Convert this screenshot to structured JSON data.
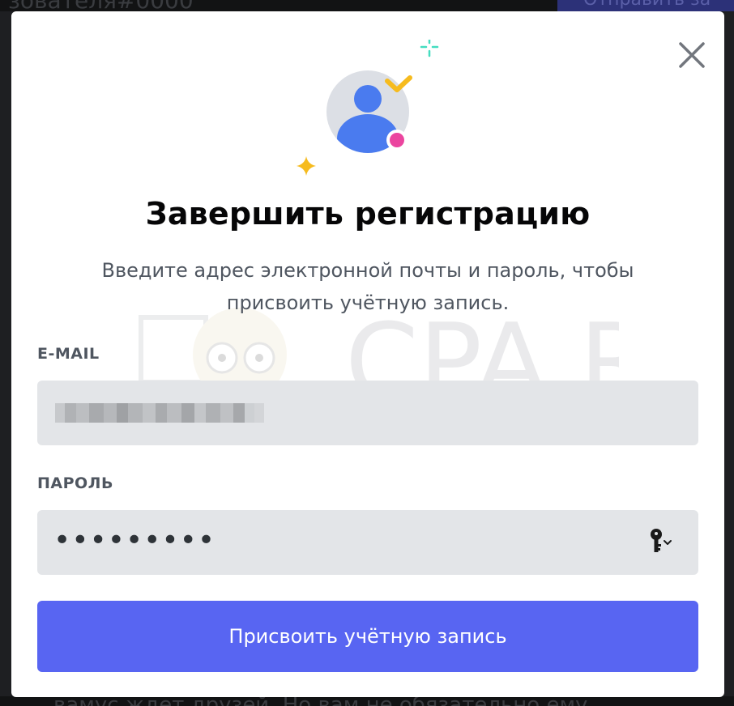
{
  "background": {
    "top_left_text": "зователя#0000",
    "top_right_button": "Отправить за",
    "bottom_text": "вамус ждет друзей. Но вам не обязательно ему"
  },
  "modal": {
    "title": "Завершить регистрацию",
    "subtitle": "Введите адрес электронной почты и пароль, чтобы присвоить учётную запись.",
    "close_icon": "close-icon",
    "illustration_icon": "user-verified-icon",
    "watermark_text": "CPA.RIP",
    "email": {
      "label": "E-MAIL",
      "value_redacted": true
    },
    "password": {
      "label": "ПАРОЛЬ",
      "value": "•••••••••",
      "icon": "key-dropdown-icon"
    },
    "submit_label": "Присвоить учётную запись"
  },
  "colors": {
    "accent": "#5865f2",
    "input_bg": "#e3e5e8",
    "title": "#060607",
    "muted": "#4f5660",
    "avatar_blue": "#4a7bef",
    "check_yellow": "#f6bb1e",
    "sparkle_cyan": "#45ddc0",
    "status_pink": "#eb459f"
  }
}
